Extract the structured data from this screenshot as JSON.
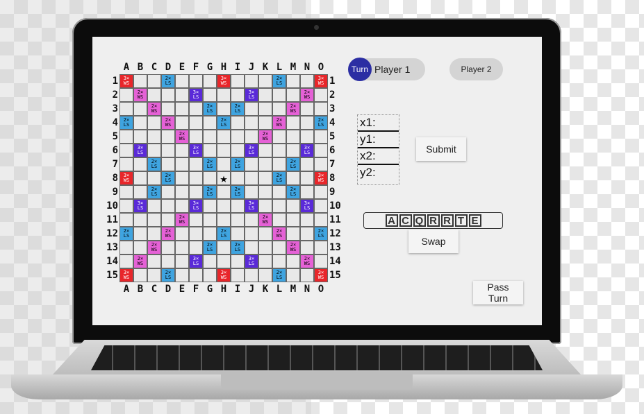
{
  "board": {
    "columns": [
      "A",
      "B",
      "C",
      "D",
      "E",
      "F",
      "G",
      "H",
      "I",
      "J",
      "K",
      "L",
      "M",
      "N",
      "O"
    ],
    "rows": [
      "1",
      "2",
      "3",
      "4",
      "5",
      "6",
      "7",
      "8",
      "9",
      "10",
      "11",
      "12",
      "13",
      "14",
      "15"
    ],
    "premium_labels": {
      "tw": [
        "3×",
        "WS"
      ],
      "dw": [
        "2×",
        "WS"
      ],
      "tl": [
        "3×",
        "LS"
      ],
      "dl": [
        "2×",
        "LS"
      ]
    },
    "center_symbol": "★",
    "layout": [
      [
        "tw",
        "",
        "",
        "dl",
        "",
        "",
        "",
        "tw",
        "",
        "",
        "",
        "dl",
        "",
        "",
        "tw"
      ],
      [
        "",
        "dw",
        "",
        "",
        "",
        "tl",
        "",
        "",
        "",
        "tl",
        "",
        "",
        "",
        "dw",
        ""
      ],
      [
        "",
        "",
        "dw",
        "",
        "",
        "",
        "dl",
        "",
        "dl",
        "",
        "",
        "",
        "dw",
        "",
        ""
      ],
      [
        "dl",
        "",
        "",
        "dw",
        "",
        "",
        "",
        "dl",
        "",
        "",
        "",
        "dw",
        "",
        "",
        "dl"
      ],
      [
        "",
        "",
        "",
        "",
        "dw",
        "",
        "",
        "",
        "",
        "",
        "dw",
        "",
        "",
        "",
        ""
      ],
      [
        "",
        "tl",
        "",
        "",
        "",
        "tl",
        "",
        "",
        "",
        "tl",
        "",
        "",
        "",
        "tl",
        ""
      ],
      [
        "",
        "",
        "dl",
        "",
        "",
        "",
        "dl",
        "",
        "dl",
        "",
        "",
        "",
        "dl",
        "",
        ""
      ],
      [
        "tw",
        "",
        "",
        "dl",
        "",
        "",
        "",
        "star",
        "",
        "",
        "",
        "dl",
        "",
        "",
        "tw"
      ],
      [
        "",
        "",
        "dl",
        "",
        "",
        "",
        "dl",
        "",
        "dl",
        "",
        "",
        "",
        "dl",
        "",
        ""
      ],
      [
        "",
        "tl",
        "",
        "",
        "",
        "tl",
        "",
        "",
        "",
        "tl",
        "",
        "",
        "",
        "tl",
        ""
      ],
      [
        "",
        "",
        "",
        "",
        "dw",
        "",
        "",
        "",
        "",
        "",
        "dw",
        "",
        "",
        "",
        ""
      ],
      [
        "dl",
        "",
        "",
        "dw",
        "",
        "",
        "",
        "dl",
        "",
        "",
        "",
        "dw",
        "",
        "",
        "dl"
      ],
      [
        "",
        "",
        "dw",
        "",
        "",
        "",
        "dl",
        "",
        "dl",
        "",
        "",
        "",
        "dw",
        "",
        ""
      ],
      [
        "",
        "dw",
        "",
        "",
        "",
        "tl",
        "",
        "",
        "",
        "tl",
        "",
        "",
        "",
        "dw",
        ""
      ],
      [
        "tw",
        "",
        "",
        "dl",
        "",
        "",
        "",
        "tw",
        "",
        "",
        "",
        "dl",
        "",
        "",
        "tw"
      ]
    ]
  },
  "players": {
    "turn_badge": "Turn",
    "player1": "Player 1",
    "player2": "Player 2"
  },
  "coords": {
    "x1": "x1:",
    "y1": "y1:",
    "x2": "x2:",
    "y2": "y2:"
  },
  "buttons": {
    "submit": "Submit",
    "swap": "Swap",
    "pass": "Pass Turn"
  },
  "rack": [
    "A",
    "C",
    "Q",
    "R",
    "R",
    "T",
    "E"
  ],
  "colors": {
    "triple_word": "#e8262a",
    "double_word": "#e561d6",
    "triple_letter": "#5a2ad8",
    "double_letter": "#3fa4e0",
    "turn_badge": "#2b2ea3"
  }
}
